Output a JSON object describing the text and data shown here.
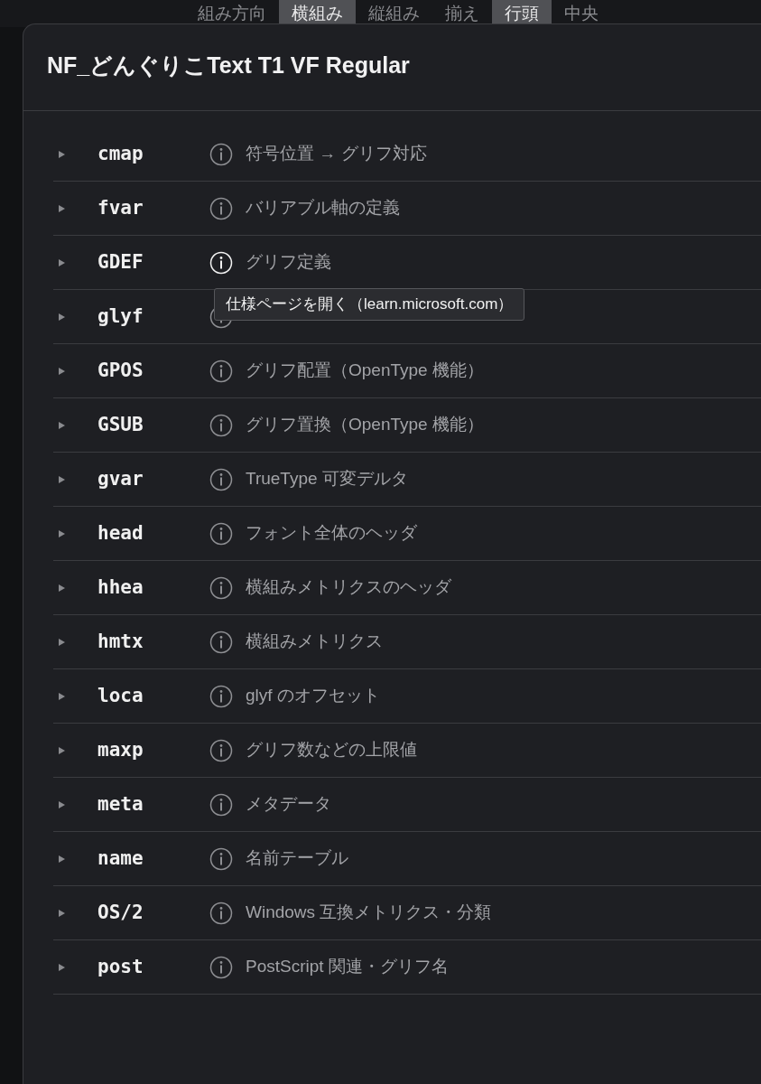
{
  "background_tabs": [
    {
      "label": "組み方向",
      "selected": false
    },
    {
      "label": "横組み",
      "selected": true
    },
    {
      "label": "縦組み",
      "selected": false
    },
    {
      "label": "揃え",
      "selected": false
    },
    {
      "label": "行頭",
      "selected": true
    },
    {
      "label": "中央",
      "selected": false
    }
  ],
  "dialog": {
    "title": "NF_どんぐりこText T1 VF Regular",
    "tables": [
      {
        "tag": "cmap",
        "description": "符号位置 → グリフ対応",
        "hovered": false
      },
      {
        "tag": "fvar",
        "description": "バリアブル軸の定義",
        "hovered": false
      },
      {
        "tag": "GDEF",
        "description": "グリフ定義",
        "hovered": true,
        "tooltip": "仕様ページを開く（learn.microsoft.com）"
      },
      {
        "tag": "glyf",
        "hovered": false
      },
      {
        "tag": "GPOS",
        "description": "グリフ配置（OpenType 機能）",
        "hovered": false
      },
      {
        "tag": "GSUB",
        "description": "グリフ置換（OpenType 機能）",
        "hovered": false
      },
      {
        "tag": "gvar",
        "description": "TrueType 可変デルタ",
        "hovered": false
      },
      {
        "tag": "head",
        "description": "フォント全体のヘッダ",
        "hovered": false
      },
      {
        "tag": "hhea",
        "description": "横組みメトリクスのヘッダ",
        "hovered": false
      },
      {
        "tag": "hmtx",
        "description": "横組みメトリクス",
        "hovered": false
      },
      {
        "tag": "loca",
        "description": "glyf のオフセット",
        "hovered": false
      },
      {
        "tag": "maxp",
        "description": "グリフ数などの上限値",
        "hovered": false
      },
      {
        "tag": "meta",
        "description": "メタデータ",
        "hovered": false
      },
      {
        "tag": "name",
        "description": "名前テーブル",
        "hovered": false
      },
      {
        "tag": "OS/2",
        "description": "Windows 互換メトリクス・分類",
        "hovered": false
      },
      {
        "tag": "post",
        "description": "PostScript 関連・グリフ名",
        "hovered": false
      }
    ]
  }
}
